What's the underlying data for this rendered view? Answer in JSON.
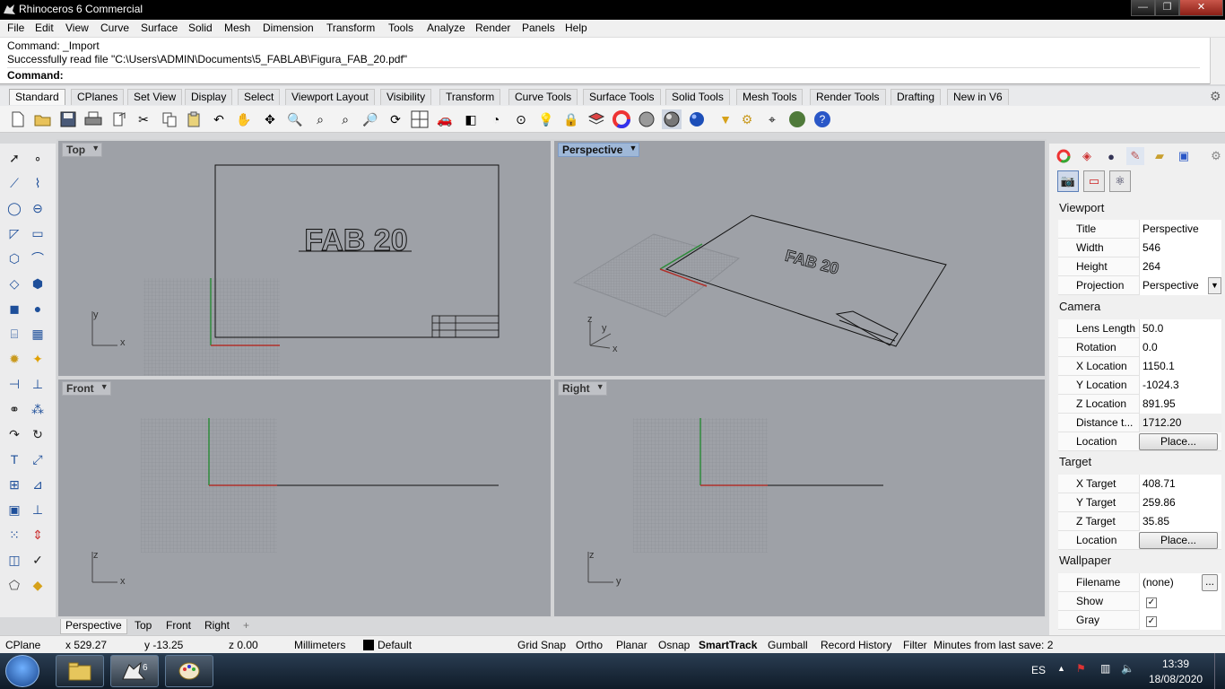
{
  "window": {
    "title": "Rhinoceros 6 Commercial",
    "minimize": "—",
    "maximize": "❐",
    "close": "✕"
  },
  "menu": [
    "File",
    "Edit",
    "View",
    "Curve",
    "Surface",
    "Solid",
    "Mesh",
    "Dimension",
    "Transform",
    "Tools",
    "Analyze",
    "Render",
    "Panels",
    "Help"
  ],
  "command": {
    "line1": "Command: _Import",
    "line2": "Successfully read file \"C:\\Users\\ADMIN\\Documents\\5_FABLAB\\Figura_FAB_20.pdf\"",
    "prompt": "Command:"
  },
  "toolbar_tabs": [
    "Standard",
    "CPlanes",
    "Set View",
    "Display",
    "Select",
    "Viewport Layout",
    "Visibility",
    "Transform",
    "Curve Tools",
    "Surface Tools",
    "Solid Tools",
    "Mesh Tools",
    "Render Tools",
    "Drafting",
    "New in V6"
  ],
  "toolbar_icons": [
    "new-icon",
    "open-icon",
    "save-icon",
    "print-icon",
    "import-icon",
    "cut-icon",
    "copy-icon",
    "paste-icon",
    "undo-icon",
    "pan-icon",
    "rotate-view-icon",
    "zoom-icon",
    "zoom-window-icon",
    "zoom-extents-icon",
    "zoom-selected-icon",
    "rotate-icon",
    "four-viewports-icon",
    "car-icon",
    "cplane-icon",
    "grid-icon",
    "light-icon",
    "lock-icon",
    "layer-icon",
    "color-icon",
    "material-icon",
    "render-shaded-icon",
    "sphere-icon",
    "filter-icon",
    "settings-icon",
    "snap-icon",
    "rhino-render-icon",
    "help-icon"
  ],
  "viewports": {
    "top": {
      "label": "Top",
      "ax1": "y",
      "ax2": "x"
    },
    "perspective": {
      "label": "Perspective",
      "ax1": "z",
      "ax2": "y",
      "ax3": "x"
    },
    "front": {
      "label": "Front",
      "ax1": "z",
      "ax2": "x"
    },
    "right": {
      "label": "Right",
      "ax1": "z",
      "ax2": "y"
    },
    "drawing_text": "FAB 20"
  },
  "viewport_tabs": [
    "Perspective",
    "Top",
    "Front",
    "Right",
    "+"
  ],
  "panel": {
    "viewport_header": "Viewport",
    "title_label": "Title",
    "title_value": "Perspective",
    "width_label": "Width",
    "width_value": "546",
    "height_label": "Height",
    "height_value": "264",
    "projection_label": "Projection",
    "projection_value": "Perspective",
    "camera_header": "Camera",
    "lens_label": "Lens Length",
    "lens_value": "50.0",
    "rotation_label": "Rotation",
    "rotation_value": "0.0",
    "xloc_label": "X Location",
    "xloc_value": "1150.1",
    "yloc_label": "Y Location",
    "yloc_value": "-1024.3",
    "zloc_label": "Z Location",
    "zloc_value": "891.95",
    "dist_label": "Distance t...",
    "dist_value": "1712.20",
    "cam_location_label": "Location",
    "place_button": "Place...",
    "target_header": "Target",
    "xt_label": "X Target",
    "xt_value": "408.71",
    "yt_label": "Y Target",
    "yt_value": "259.86",
    "zt_label": "Z Target",
    "zt_value": "35.85",
    "tgt_location_label": "Location",
    "wallpaper_header": "Wallpaper",
    "filename_label": "Filename",
    "filename_value": "(none)",
    "browse_button": "...",
    "show_label": "Show",
    "show_checked": "✓",
    "gray_label": "Gray",
    "gray_checked": "✓"
  },
  "status": {
    "cplane": "CPlane",
    "x": "x 529.27",
    "y": "y -13.25",
    "z": "z 0.00",
    "units": "Millimeters",
    "layer": "Default",
    "grid_snap": "Grid Snap",
    "ortho": "Ortho",
    "planar": "Planar",
    "osnap": "Osnap",
    "smarttrack": "SmartTrack",
    "gumball": "Gumball",
    "record_history": "Record History",
    "filter": "Filter",
    "minutes": "Minutes from last save: 2"
  },
  "taskbar": {
    "lang": "ES",
    "time": "13:39",
    "date": "18/08/2020"
  },
  "colors": {
    "viewport_bg": "#9ea1a7",
    "grid": "#8a8d93",
    "x_axis": "#b0302a",
    "y_axis": "#2e8b3a"
  }
}
